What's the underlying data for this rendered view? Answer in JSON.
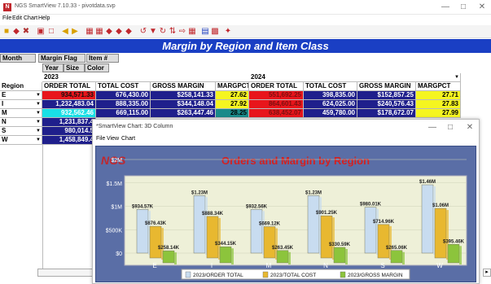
{
  "window": {
    "title": "NGS SmartView 7.10.33 - pivotdata.svp",
    "min": "—",
    "max": "□",
    "close": "✕"
  },
  "menu": [
    "File",
    "Edit",
    "Chart",
    "Help"
  ],
  "toolbar_icons": [
    "open-icon",
    "save-icon",
    "settings-icon",
    "print-icon",
    "preview-icon",
    "back-icon",
    "forward-icon",
    "grid-icon",
    "table-icon",
    "diamond-icon",
    "diamond2-icon",
    "diamond3-icon",
    "drill-icon",
    "filter-icon",
    "pivot-icon",
    "sort-icon",
    "export-icon",
    "options-icon",
    "chart-icon",
    "bar-chart-icon",
    "star-icon"
  ],
  "banner": "Margin by Region and Item Class",
  "pivot": {
    "col_buttons": [
      "Month",
      "Margin Flag",
      "Item #"
    ],
    "row_buttons": [
      "Year",
      "Size",
      "Color"
    ],
    "year_2023": "2023",
    "year_2024": "2024",
    "region_label": "Region",
    "headers": [
      "ORDER TOTAL",
      "TOTAL COST",
      "GROSS MARGIN",
      "MARGPCT",
      "ORDER TOTAL",
      "TOTAL COST",
      "GROSS MARGIN",
      "MARGPCT"
    ],
    "rows": [
      {
        "region": "E",
        "vals": [
          "934,571.33",
          "676,430.00",
          "$258,141.33",
          "27.62",
          "551,692.25",
          "398,835.00",
          "$152,857.25",
          "27.71"
        ],
        "bg0": "#e8151b",
        "fg0": "#111"
      },
      {
        "region": "I",
        "vals": [
          "1,232,483.04",
          "888,335.00",
          "$344,148.04",
          "27.92",
          "864,601.43",
          "624,025.00",
          "$240,576.43",
          "27.83"
        ],
        "bg0": "#1f1f8c",
        "fg0": "#fff"
      },
      {
        "region": "M",
        "vals": [
          "932,562.46",
          "669,115.00",
          "$263,447.46",
          "28.25",
          "638,452.07",
          "459,780.00",
          "$178,672.07",
          "27.99"
        ],
        "bg0": "#19e0e6",
        "fg0": "#fff"
      },
      {
        "region": "N",
        "vals": [
          "1,231,837.4"
        ],
        "bg0": "#1f1f8c",
        "fg0": "#fff"
      },
      {
        "region": "S",
        "vals": [
          "980,014.5"
        ],
        "bg0": "#1f1f8c",
        "fg0": "#fff"
      },
      {
        "region": "W",
        "vals": [
          "1,458,849.4"
        ],
        "bg0": "#1f1f8c",
        "fg0": "#fff"
      }
    ]
  },
  "chart_window": {
    "title": "*SmartView Chart: 3D Column",
    "menu": [
      "File",
      "View",
      "Chart"
    ],
    "min": "—",
    "max": "□",
    "close": "✕"
  },
  "chart_data": {
    "type": "bar",
    "title": "Orders and Margin by Region",
    "logo": "NGS",
    "categories": [
      "E",
      "I",
      "M",
      "N",
      "S",
      "W"
    ],
    "ylabels": [
      "$0",
      "$500K",
      "$1M",
      "$1.5M",
      "$2M"
    ],
    "ylim": [
      0,
      2000
    ],
    "series": [
      {
        "name": "2023/ORDER TOTAL",
        "values": [
          934.57,
          1230,
          932.56,
          1230,
          980.01,
          1460
        ],
        "labels": [
          "$934.57K",
          "$1.23M",
          "$932.56K",
          "$1.23M",
          "$980.01K",
          "$1.46M"
        ],
        "color": "#c8dcf0"
      },
      {
        "name": "2023/TOTAL COST",
        "values": [
          676.43,
          888.34,
          669.12,
          901.25,
          714.96,
          1060
        ],
        "labels": [
          "$676.43K",
          "$888.34K",
          "$669.12K",
          "$901.25K",
          "$714.96K",
          "$1.06M"
        ],
        "color": "#e8b830"
      },
      {
        "name": "2023/GROSS MARGIN",
        "values": [
          258.14,
          344.15,
          263.45,
          330.59,
          265.06,
          395.46
        ],
        "labels": [
          "$258.14K",
          "$344.15K",
          "$263.45K",
          "$330.59K",
          "$265.06K",
          "$395.46K"
        ],
        "color": "#8cc43c"
      }
    ]
  }
}
